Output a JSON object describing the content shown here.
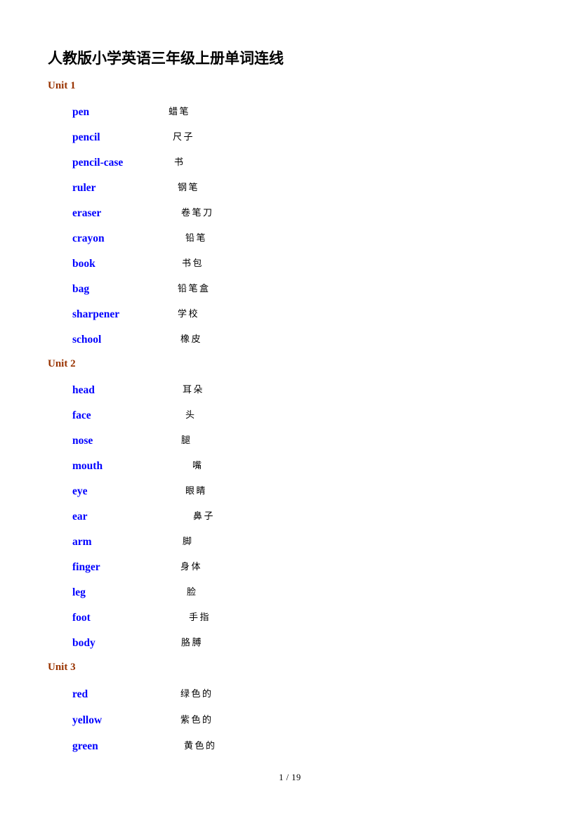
{
  "document": {
    "title": "人教版小学英语三年级上册单词连线",
    "footer": {
      "current_page": "1",
      "separator": "/",
      "total_pages": "19",
      "text": "1  /  19"
    }
  },
  "units": [
    {
      "heading": "Unit 1",
      "rows": [
        {
          "en": "pen",
          "zh": "蜡笔",
          "indent": 172
        },
        {
          "en": "pencil",
          "zh": "尺子",
          "indent": 178
        },
        {
          "en": "pencil-case",
          "zh": "书",
          "indent": 180
        },
        {
          "en": "ruler",
          "zh": "钢笔",
          "indent": 185
        },
        {
          "en": "eraser",
          "zh": "卷笔刀",
          "indent": 190
        },
        {
          "en": "crayon",
          "zh": "铅笔",
          "indent": 196
        },
        {
          "en": "book",
          "zh": "书包",
          "indent": 191
        },
        {
          "en": "bag",
          "zh": "铅笔盒",
          "indent": 185
        },
        {
          "en": "sharpener",
          "zh": "学校",
          "indent": 185
        },
        {
          "en": "school",
          "zh": "橡皮",
          "indent": 189
        }
      ]
    },
    {
      "heading": "Unit 2",
      "rows": [
        {
          "en": "head",
          "zh": "耳朵",
          "indent": 192
        },
        {
          "en": "face",
          "zh": "头",
          "indent": 196
        },
        {
          "en": "nose",
          "zh": "腿",
          "indent": 190
        },
        {
          "en": "mouth",
          "zh": "嘴",
          "indent": 206
        },
        {
          "en": "eye",
          "zh": "眼睛",
          "indent": 196
        },
        {
          "en": "ear",
          "zh": "鼻子",
          "indent": 207
        },
        {
          "en": "arm",
          "zh": "脚",
          "indent": 192
        },
        {
          "en": "finger",
          "zh": "身体",
          "indent": 189
        },
        {
          "en": "leg",
          "zh": "脸",
          "indent": 198
        },
        {
          "en": "foot",
          "zh": "手指",
          "indent": 201
        },
        {
          "en": "body",
          "zh": "胳膊",
          "indent": 190
        }
      ]
    },
    {
      "heading": "Unit 3",
      "rows": [
        {
          "en": "red",
          "zh": "绿色的",
          "indent": 189
        },
        {
          "en": "yellow",
          "zh": "紫色的",
          "indent": 189
        },
        {
          "en": "green",
          "zh": "黄色的",
          "indent": 194
        }
      ]
    }
  ],
  "colors": {
    "english_word": "#0000FF",
    "unit_heading": "#993300",
    "chinese_word": "#000000",
    "title": "#000000",
    "page_background": "#FFFFFF"
  }
}
